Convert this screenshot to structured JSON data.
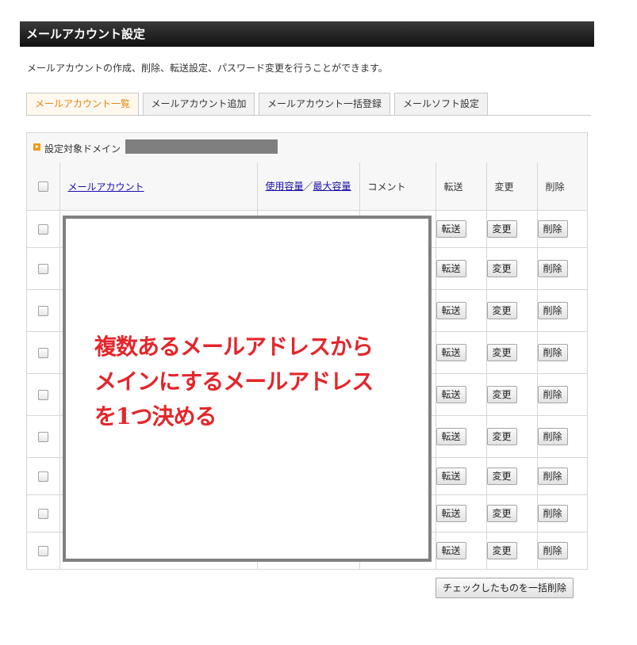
{
  "page_title": "メールアカウント設定",
  "description": "メールアカウントの作成、削除、転送設定、パスワード変更を行うことができます。",
  "tabs": [
    {
      "label": "メールアカウント一覧",
      "active": true
    },
    {
      "label": "メールアカウント追加",
      "active": false
    },
    {
      "label": "メールアカウント一括登録",
      "active": false
    },
    {
      "label": "メールソフト設定",
      "active": false
    }
  ],
  "domain_label": "設定対象ドメイン",
  "table": {
    "headers": {
      "account": "メールアカウント",
      "usage": "使用容量",
      "separator": "／",
      "max": "最大容量",
      "comment": "コメント",
      "forward": "転送",
      "change": "変更",
      "delete": "削除"
    },
    "row_buttons": {
      "forward": "転送",
      "change": "変更",
      "delete": "削除"
    }
  },
  "overlay": {
    "lines": [
      "複数あるメールアドレスから",
      "メインにするメールアドレス",
      "を1つ決める"
    ],
    "text_color": "#e3262b"
  },
  "bulk_delete_label": "チェックしたものを一括削除",
  "colors": {
    "accent": "#e8820c",
    "title_bar": "#1c1c1c",
    "link": "#1a0dab"
  }
}
